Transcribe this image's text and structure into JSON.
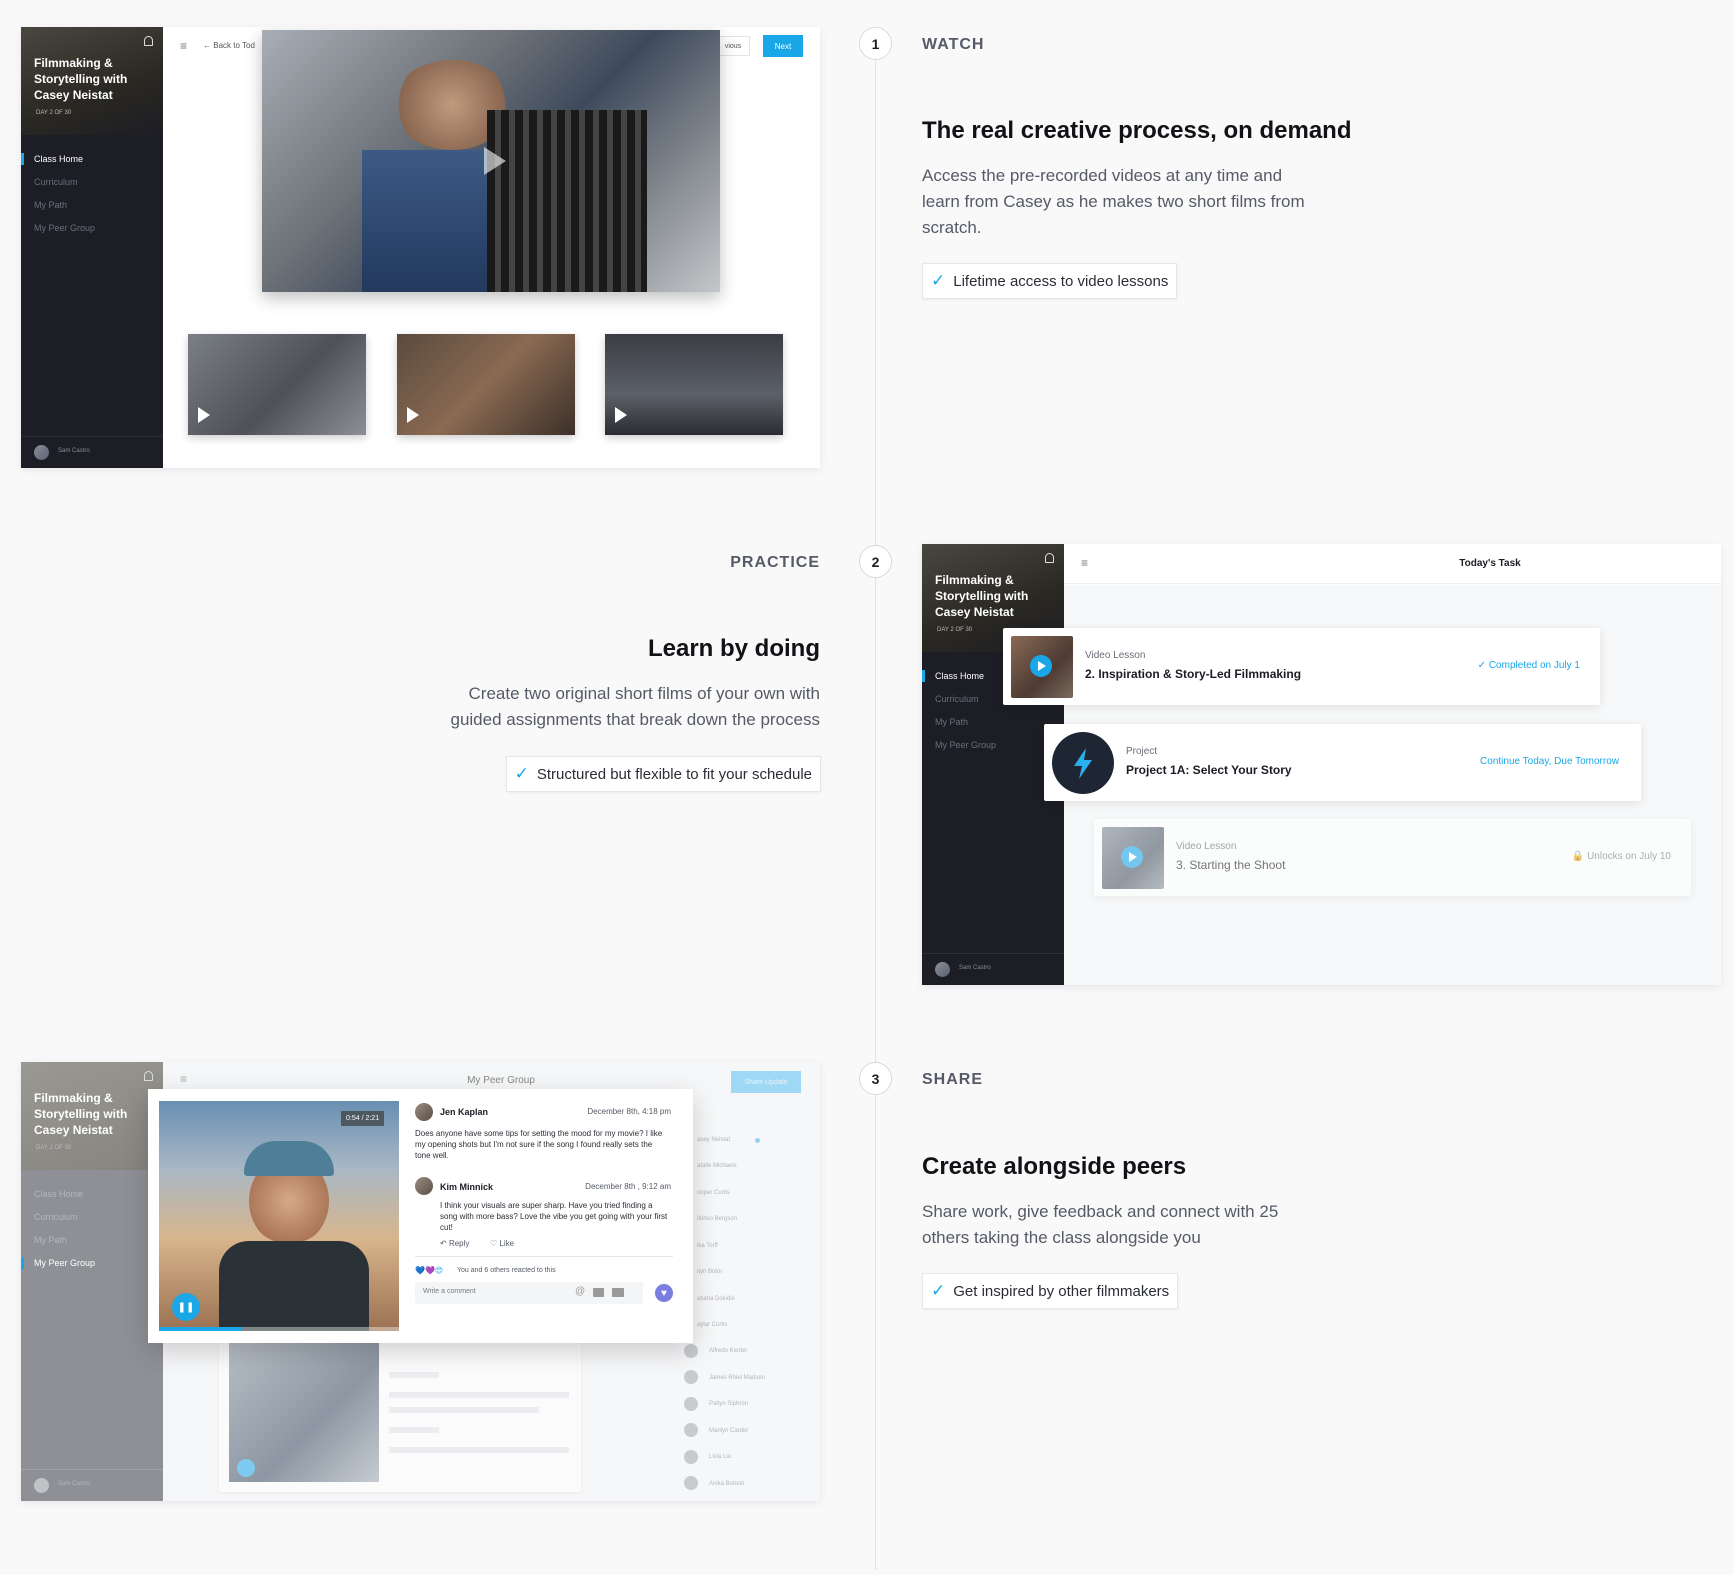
{
  "app": {
    "course_title": "Filmmaking & Storytelling with Casey Neistat",
    "day_label": "DAY 2 OF 30",
    "nav": [
      "Class Home",
      "Curriculum",
      "My Path",
      "My Peer Group"
    ],
    "user_name": "Sam Castro"
  },
  "steps": [
    {
      "number": "1",
      "label": "WATCH",
      "title": "The real creative process, on demand",
      "description": "Access the pre-recorded videos at any time and learn from Casey as he makes two short films from scratch.",
      "chip": "Lifetime access to video lessons"
    },
    {
      "number": "2",
      "label": "PRACTICE",
      "title": "Learn by doing",
      "description": "Create two original short films of your own with guided assignments that break down the process",
      "chip": "Structured but flexible to fit your schedule"
    },
    {
      "number": "3",
      "label": "SHARE",
      "title": "Create alongside peers",
      "description": "Share work, give feedback and connect with 25 others taking the class alongside you",
      "chip": "Get inspired by other filmmakers"
    }
  ],
  "watch_screen": {
    "back_label": "Back to Tod",
    "previous_label": "vious",
    "next_label": "Next"
  },
  "practice_screen": {
    "header": "Today's Task",
    "tasks": [
      {
        "type": "Video Lesson",
        "title": "2. Inspiration & Story-Led Filmmaking",
        "status": "Completed on July 1"
      },
      {
        "type": "Project",
        "title": "Project 1A: Select Your Story",
        "status": "Continue Today, Due Tomorrow"
      },
      {
        "type": "Video Lesson",
        "title": "3. Starting the Shoot",
        "status": "Unlocks on July 10"
      }
    ]
  },
  "share_screen": {
    "header": "My Peer Group",
    "share_button": "Share Update",
    "video_time": "0:54 / 2:21",
    "comments": [
      {
        "name": "Jen Kaplan",
        "date": "December 8th, 4:18 pm",
        "text": "Does anyone have some tips for setting the mood for my movie? I like my opening shots but I'm not sure if the song I found really sets the tone well."
      },
      {
        "name": "Kim Minnick",
        "date": "December 8th , 9:12 am",
        "text": "I think your visuals are super sharp. Have you tried finding a song with more bass? Love the vibe you get going with your first cut!"
      }
    ],
    "reply_label": "Reply",
    "like_label": "Like",
    "reactions": "You and 6 others reacted to this",
    "comment_placeholder": "Write a comment",
    "peers": [
      "asey Neistat",
      "atalie Michaels",
      "ooper Curtis",
      "ifonso Bergson",
      "ika Torff",
      "ityn Botor",
      "atiana Dokidis",
      "aylar Curtis",
      "Alfredo Kenter",
      "James Rhiel Madsen",
      "Paityn Siphron",
      "Marilyn Carder",
      "Livia Liu",
      "Anika Botosh"
    ]
  }
}
